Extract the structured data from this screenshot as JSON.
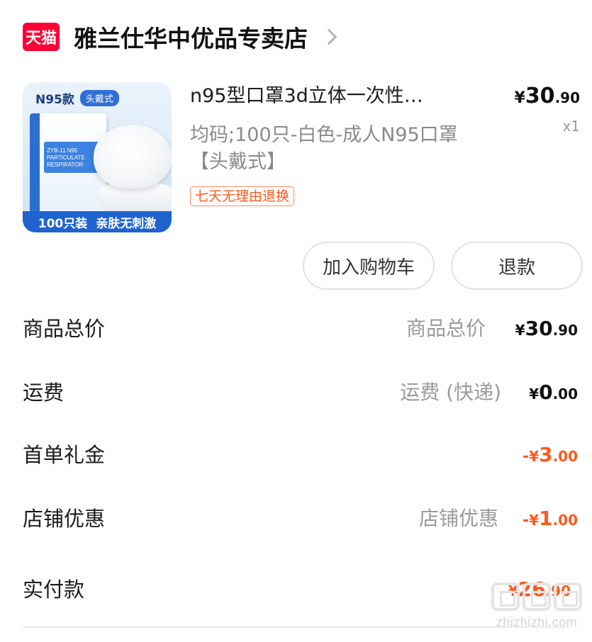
{
  "store": {
    "badge_label": "天猫",
    "name": "雅兰仕华中优品专卖店"
  },
  "product": {
    "thumb": {
      "model": "N95款",
      "tag": "头戴式",
      "box_text": "ZYB-11 N95 PARTICULATE RESPIRATOR",
      "banner_left": "100只装",
      "banner_right": "亲肤无刺激"
    },
    "title": "n95型口罩3d立体一次性…",
    "price": {
      "yen": "¥",
      "int": "30",
      "dec": ".90"
    },
    "quantity": "x1",
    "spec": "均码;100只-白色-成人N95口罩【头戴式】",
    "return_policy": "七天无理由退换",
    "buttons": {
      "add_to_cart": "加入购物车",
      "refund": "退款"
    }
  },
  "summary": {
    "goods_total": {
      "label": "商品总价",
      "sublabel": "商品总价",
      "sign": "",
      "yen": "¥",
      "int": "30",
      "dec": ".90"
    },
    "shipping": {
      "label": "运费",
      "sublabel": "运费 (快递)",
      "sign": "",
      "yen": "¥",
      "int": "0",
      "dec": ".00"
    },
    "first_order_gift": {
      "label": "首单礼金",
      "sign": "-",
      "yen": "¥",
      "int": "3",
      "dec": ".00"
    },
    "store_discount": {
      "label": "店铺优惠",
      "sublabel": "店铺优惠",
      "sign": "-",
      "yen": "¥",
      "int": "1",
      "dec": ".00"
    },
    "paid": {
      "label": "实付款",
      "yen": "¥",
      "int": "26",
      "dec": ".90"
    }
  },
  "watermark": {
    "text": "zhizhizhi.com"
  },
  "colors": {
    "tmall_red": "#ff0036",
    "discount_orange": "#ff5a1f",
    "muted_text": "#9a9a9a"
  }
}
